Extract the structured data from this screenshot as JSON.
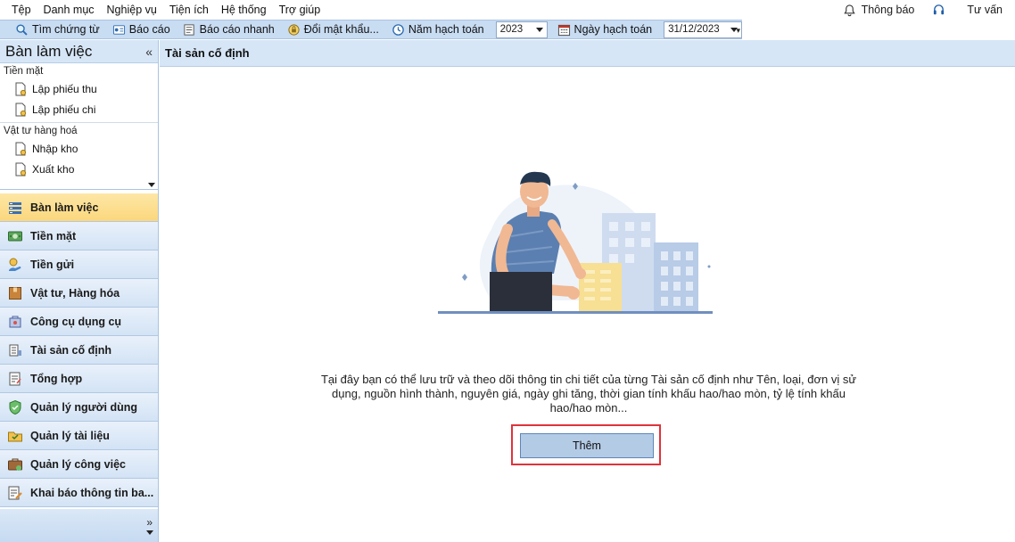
{
  "menu": {
    "items": [
      "Tệp",
      "Danh mục",
      "Nghiệp vụ",
      "Tiện ích",
      "Hệ thống",
      "Trợ giúp"
    ],
    "notifications_label": "Thông báo",
    "consult_label": "Tư vấn"
  },
  "toolbar": {
    "search_vouchers": "Tìm chứng từ",
    "reports": "Báo cáo",
    "quick_reports": "Báo cáo nhanh",
    "change_password": "Đổi mật khẩu...",
    "fiscal_year_label": "Năm hạch toán",
    "fiscal_year_value": "2023",
    "posting_date_label": "Ngày hạch toán",
    "posting_date_value": "31/12/2023"
  },
  "sidebar": {
    "title": "Bàn làm việc",
    "collapse_glyph": "«",
    "groups": [
      {
        "label": "Tiền mặt",
        "items": [
          "Lập phiếu thu",
          "Lập phiếu chi"
        ]
      },
      {
        "label": "Vật tư hàng hoá",
        "items": [
          "Nhập kho",
          "Xuất kho"
        ]
      }
    ],
    "modules": [
      {
        "label": "Bàn làm việc",
        "icon": "desk-icon",
        "active": true
      },
      {
        "label": "Tiền mặt",
        "icon": "cash-icon",
        "active": false
      },
      {
        "label": "Tiền gửi",
        "icon": "deposit-icon",
        "active": false
      },
      {
        "label": "Vật tư, Hàng hóa",
        "icon": "goods-box-icon",
        "active": false
      },
      {
        "label": "Công cụ dụng cụ",
        "icon": "tools-icon",
        "active": false
      },
      {
        "label": "Tài sản cố định",
        "icon": "fixed-asset-icon",
        "active": false
      },
      {
        "label": "Tổng hợp",
        "icon": "summary-icon",
        "active": false
      },
      {
        "label": "Quản lý người dùng",
        "icon": "user-shield-icon",
        "active": false
      },
      {
        "label": "Quản lý tài liệu",
        "icon": "folder-icon",
        "active": false
      },
      {
        "label": "Quản lý công việc",
        "icon": "briefcase-icon",
        "active": false
      },
      {
        "label": "Khai báo thông tin ba...",
        "icon": "declaration-icon",
        "active": false
      }
    ],
    "footer_glyph": "»"
  },
  "content": {
    "header": "Tài sản cố định",
    "description": "Tại đây bạn có thể lưu trữ và theo dõi thông tin chi tiết của từng Tài sản cố định như Tên, loại, đơn vị sử dụng, nguồn hình thành, nguyên giá, ngày ghi tăng, thời gian tính khấu hao/hao mòn, tỷ lệ tính khấu hao/hao mòn...",
    "add_button": "Thêm"
  },
  "colors": {
    "toolbar_bg": "#c8dcf2",
    "panel_header_bg": "#d6e6f7",
    "active_module_bg": "#fbd77c",
    "highlight_border": "#e0333b",
    "add_button_bg": "#b4cbe6"
  }
}
